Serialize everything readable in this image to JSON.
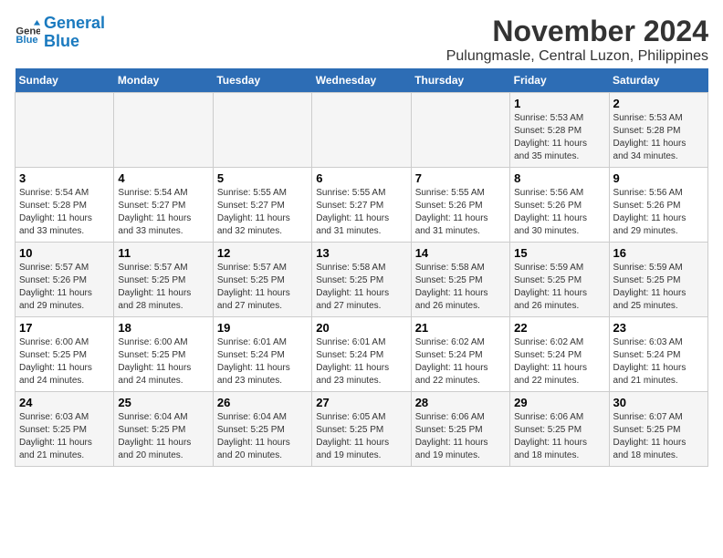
{
  "logo": {
    "line1": "General",
    "line2": "Blue"
  },
  "title": "November 2024",
  "subtitle": "Pulungmasle, Central Luzon, Philippines",
  "weekdays": [
    "Sunday",
    "Monday",
    "Tuesday",
    "Wednesday",
    "Thursday",
    "Friday",
    "Saturday"
  ],
  "weeks": [
    [
      {
        "day": "",
        "info": ""
      },
      {
        "day": "",
        "info": ""
      },
      {
        "day": "",
        "info": ""
      },
      {
        "day": "",
        "info": ""
      },
      {
        "day": "",
        "info": ""
      },
      {
        "day": "1",
        "info": "Sunrise: 5:53 AM\nSunset: 5:28 PM\nDaylight: 11 hours\nand 35 minutes."
      },
      {
        "day": "2",
        "info": "Sunrise: 5:53 AM\nSunset: 5:28 PM\nDaylight: 11 hours\nand 34 minutes."
      }
    ],
    [
      {
        "day": "3",
        "info": "Sunrise: 5:54 AM\nSunset: 5:28 PM\nDaylight: 11 hours\nand 33 minutes."
      },
      {
        "day": "4",
        "info": "Sunrise: 5:54 AM\nSunset: 5:27 PM\nDaylight: 11 hours\nand 33 minutes."
      },
      {
        "day": "5",
        "info": "Sunrise: 5:55 AM\nSunset: 5:27 PM\nDaylight: 11 hours\nand 32 minutes."
      },
      {
        "day": "6",
        "info": "Sunrise: 5:55 AM\nSunset: 5:27 PM\nDaylight: 11 hours\nand 31 minutes."
      },
      {
        "day": "7",
        "info": "Sunrise: 5:55 AM\nSunset: 5:26 PM\nDaylight: 11 hours\nand 31 minutes."
      },
      {
        "day": "8",
        "info": "Sunrise: 5:56 AM\nSunset: 5:26 PM\nDaylight: 11 hours\nand 30 minutes."
      },
      {
        "day": "9",
        "info": "Sunrise: 5:56 AM\nSunset: 5:26 PM\nDaylight: 11 hours\nand 29 minutes."
      }
    ],
    [
      {
        "day": "10",
        "info": "Sunrise: 5:57 AM\nSunset: 5:26 PM\nDaylight: 11 hours\nand 29 minutes."
      },
      {
        "day": "11",
        "info": "Sunrise: 5:57 AM\nSunset: 5:25 PM\nDaylight: 11 hours\nand 28 minutes."
      },
      {
        "day": "12",
        "info": "Sunrise: 5:57 AM\nSunset: 5:25 PM\nDaylight: 11 hours\nand 27 minutes."
      },
      {
        "day": "13",
        "info": "Sunrise: 5:58 AM\nSunset: 5:25 PM\nDaylight: 11 hours\nand 27 minutes."
      },
      {
        "day": "14",
        "info": "Sunrise: 5:58 AM\nSunset: 5:25 PM\nDaylight: 11 hours\nand 26 minutes."
      },
      {
        "day": "15",
        "info": "Sunrise: 5:59 AM\nSunset: 5:25 PM\nDaylight: 11 hours\nand 26 minutes."
      },
      {
        "day": "16",
        "info": "Sunrise: 5:59 AM\nSunset: 5:25 PM\nDaylight: 11 hours\nand 25 minutes."
      }
    ],
    [
      {
        "day": "17",
        "info": "Sunrise: 6:00 AM\nSunset: 5:25 PM\nDaylight: 11 hours\nand 24 minutes."
      },
      {
        "day": "18",
        "info": "Sunrise: 6:00 AM\nSunset: 5:25 PM\nDaylight: 11 hours\nand 24 minutes."
      },
      {
        "day": "19",
        "info": "Sunrise: 6:01 AM\nSunset: 5:24 PM\nDaylight: 11 hours\nand 23 minutes."
      },
      {
        "day": "20",
        "info": "Sunrise: 6:01 AM\nSunset: 5:24 PM\nDaylight: 11 hours\nand 23 minutes."
      },
      {
        "day": "21",
        "info": "Sunrise: 6:02 AM\nSunset: 5:24 PM\nDaylight: 11 hours\nand 22 minutes."
      },
      {
        "day": "22",
        "info": "Sunrise: 6:02 AM\nSunset: 5:24 PM\nDaylight: 11 hours\nand 22 minutes."
      },
      {
        "day": "23",
        "info": "Sunrise: 6:03 AM\nSunset: 5:24 PM\nDaylight: 11 hours\nand 21 minutes."
      }
    ],
    [
      {
        "day": "24",
        "info": "Sunrise: 6:03 AM\nSunset: 5:25 PM\nDaylight: 11 hours\nand 21 minutes."
      },
      {
        "day": "25",
        "info": "Sunrise: 6:04 AM\nSunset: 5:25 PM\nDaylight: 11 hours\nand 20 minutes."
      },
      {
        "day": "26",
        "info": "Sunrise: 6:04 AM\nSunset: 5:25 PM\nDaylight: 11 hours\nand 20 minutes."
      },
      {
        "day": "27",
        "info": "Sunrise: 6:05 AM\nSunset: 5:25 PM\nDaylight: 11 hours\nand 19 minutes."
      },
      {
        "day": "28",
        "info": "Sunrise: 6:06 AM\nSunset: 5:25 PM\nDaylight: 11 hours\nand 19 minutes."
      },
      {
        "day": "29",
        "info": "Sunrise: 6:06 AM\nSunset: 5:25 PM\nDaylight: 11 hours\nand 18 minutes."
      },
      {
        "day": "30",
        "info": "Sunrise: 6:07 AM\nSunset: 5:25 PM\nDaylight: 11 hours\nand 18 minutes."
      }
    ]
  ]
}
